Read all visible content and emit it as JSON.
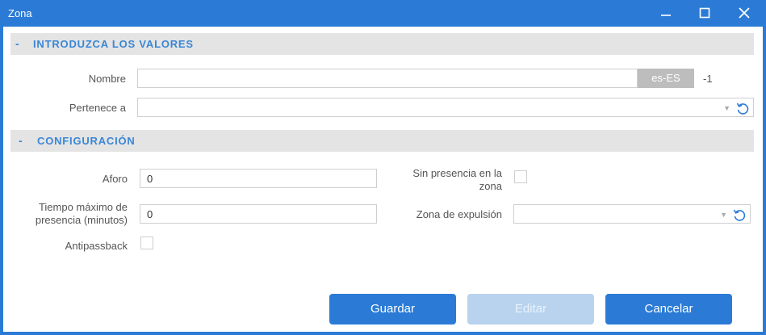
{
  "window": {
    "title": "Zona"
  },
  "sections": {
    "values": {
      "toggle": "-",
      "title": "INTRODUZCA LOS VALORES"
    },
    "config": {
      "toggle": "-",
      "title": "CONFIGURACIÓN"
    }
  },
  "fields": {
    "nombre": {
      "label": "Nombre",
      "value": "",
      "lang": "es-ES",
      "id_value": "-1"
    },
    "pertenece": {
      "label": "Pertenece a",
      "value": ""
    },
    "aforo": {
      "label": "Aforo",
      "value": "0"
    },
    "sin_presencia": {
      "label_line1": "Sin presencia en la",
      "label_line2": "zona",
      "checked": false
    },
    "tiempo_maximo": {
      "label_line1": "Tiempo máximo de",
      "label_line2": "presencia (minutos)",
      "value": "0"
    },
    "zona_expulsion": {
      "label": "Zona de expulsión",
      "value": ""
    },
    "antipassback": {
      "label": "Antipassback",
      "checked": false
    }
  },
  "buttons": {
    "guardar": "Guardar",
    "editar": "Editar",
    "cancelar": "Cancelar"
  },
  "icons": {
    "minimize": "minimize-icon",
    "maximize": "maximize-icon",
    "close": "close-icon",
    "dropdown": "chevron-down-icon",
    "reset": "undo-icon"
  },
  "colors": {
    "accent": "#2b7bd6",
    "section_bg": "#e4e4e4",
    "section_text": "#3a86d6",
    "disabled_button": "#b9d3ee",
    "lang_tag": "#bdbdbd"
  }
}
